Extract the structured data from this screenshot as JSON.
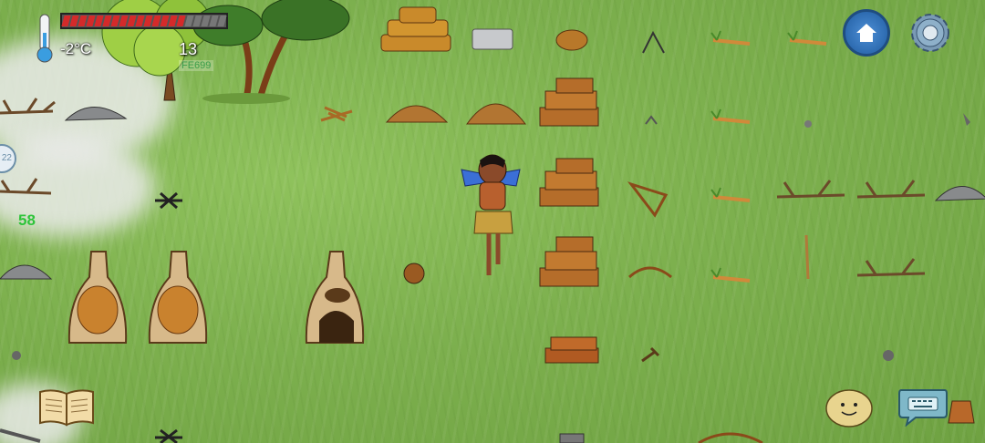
{
  "hud": {
    "temperature": "-2°C",
    "hunger_level": 0.75,
    "hunger_segments": 20,
    "yum_count": "13",
    "yum_bonus": "FE699",
    "item_counter": "58",
    "side_badge": "22"
  },
  "buttons": {
    "home_icon": "home-icon",
    "settings_icon": "gear-icon",
    "book_icon": "crafting-book-icon",
    "emote_icon": "emote-face-icon",
    "chat_icon": "keyboard-chat-icon"
  },
  "colors": {
    "hunger_fill": "#d42a2a",
    "hunger_empty": "#777777",
    "counter_green": "#2ec43a",
    "grass": "#7db04e"
  }
}
